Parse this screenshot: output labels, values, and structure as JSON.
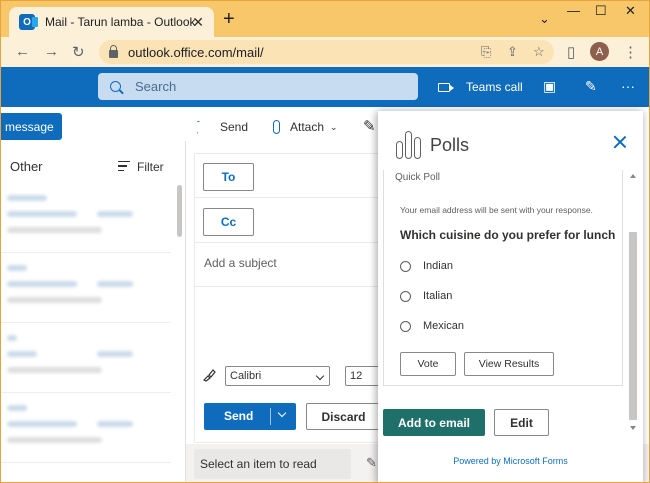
{
  "browser": {
    "tab_title": "Mail - Tarun lamba - Outlook",
    "favicon_letter": "O",
    "tab_close": "✕",
    "new_tab": "+",
    "window_controls": [
      "⌄",
      "—",
      "☐",
      "✕"
    ],
    "url": "outlook.office.com/mail/",
    "nav": {
      "back": "←",
      "forward": "→",
      "reload": "↻"
    },
    "omnibox_icons": [
      "install-icon",
      "share-icon",
      "star-icon"
    ],
    "avatar_letter": "A",
    "menu": "⋮"
  },
  "header": {
    "search_placeholder": "Search",
    "teams_call_label": "Teams call",
    "accent_color": "#0f6cbd"
  },
  "left_pane": {
    "new_message_label": "message",
    "focused_tab": "Other",
    "filter_label": "Filter"
  },
  "compose": {
    "send_command": "Send",
    "attach_command": "Attach",
    "to_label": "To",
    "cc_label": "Cc",
    "subject_placeholder": "Add a subject",
    "font_name": "Calibri",
    "font_size": "12",
    "send_label": "Send",
    "discard_label": "Discard",
    "select_item_text": "Select an item to read"
  },
  "polls": {
    "title": "Polls",
    "poll_name": "Quick Poll",
    "disclaimer": "Your email address will be sent with your response.",
    "question": "Which cuisine do you prefer for lunch",
    "options": [
      "Indian",
      "Italian",
      "Mexican"
    ],
    "vote_label": "Vote",
    "view_results_label": "View Results",
    "add_to_email_label": "Add to email",
    "edit_label": "Edit",
    "powered_by": "Powered by Microsoft Forms",
    "primary_color": "#1f6f6b"
  }
}
